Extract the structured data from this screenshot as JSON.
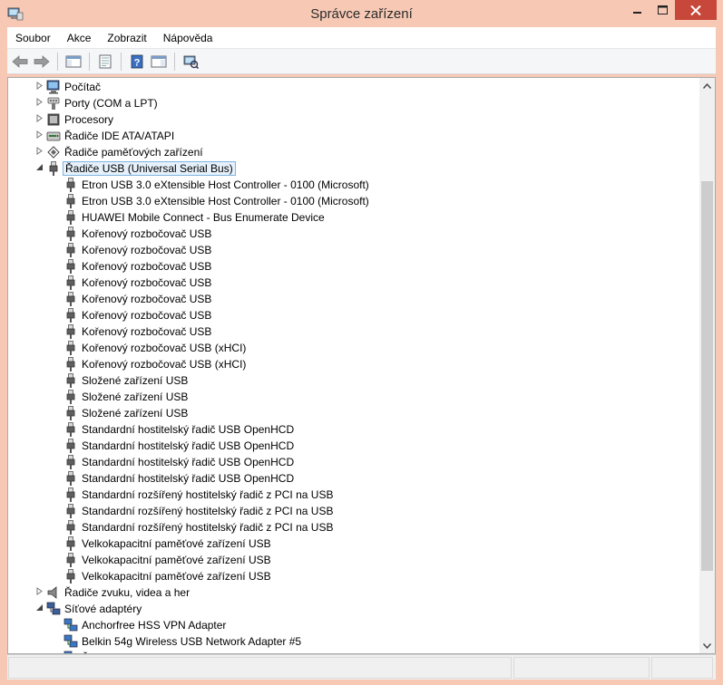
{
  "window": {
    "title": "Správce zařízení"
  },
  "menubar": [
    "Soubor",
    "Akce",
    "Zobrazit",
    "Nápověda"
  ],
  "toolbar": [
    "back-icon",
    "forward-icon",
    "show-hide-tree-icon",
    "properties-icon",
    "help-icon",
    "action-pane-icon",
    "scan-hardware-icon"
  ],
  "tree": [
    {
      "label": "Počítač",
      "level": 0,
      "expander": "collapsed",
      "icon": "computer-icon"
    },
    {
      "label": "Porty (COM a LPT)",
      "level": 0,
      "expander": "collapsed",
      "icon": "port-icon"
    },
    {
      "label": "Procesory",
      "level": 0,
      "expander": "collapsed",
      "icon": "processor-icon"
    },
    {
      "label": "Řadiče IDE ATA/ATAPI",
      "level": 0,
      "expander": "collapsed",
      "icon": "ide-controller-icon"
    },
    {
      "label": "Řadiče paměťových zařízení",
      "level": 0,
      "expander": "collapsed",
      "icon": "storage-controller-icon"
    },
    {
      "label": "Řadiče USB (Universal Serial Bus)",
      "level": 0,
      "expander": "expanded",
      "icon": "usb-icon",
      "selected": true
    },
    {
      "label": "Etron USB 3.0 eXtensible Host Controller - 0100 (Microsoft)",
      "level": 1,
      "icon": "usb-icon"
    },
    {
      "label": "Etron USB 3.0 eXtensible Host Controller - 0100 (Microsoft)",
      "level": 1,
      "icon": "usb-icon"
    },
    {
      "label": "HUAWEI Mobile Connect - Bus Enumerate Device",
      "level": 1,
      "icon": "usb-icon"
    },
    {
      "label": "Kořenový rozbočovač USB",
      "level": 1,
      "icon": "usb-icon"
    },
    {
      "label": "Kořenový rozbočovač USB",
      "level": 1,
      "icon": "usb-icon"
    },
    {
      "label": "Kořenový rozbočovač USB",
      "level": 1,
      "icon": "usb-icon"
    },
    {
      "label": "Kořenový rozbočovač USB",
      "level": 1,
      "icon": "usb-icon"
    },
    {
      "label": "Kořenový rozbočovač USB",
      "level": 1,
      "icon": "usb-icon"
    },
    {
      "label": "Kořenový rozbočovač USB",
      "level": 1,
      "icon": "usb-icon"
    },
    {
      "label": "Kořenový rozbočovač USB",
      "level": 1,
      "icon": "usb-icon"
    },
    {
      "label": "Kořenový rozbočovač USB (xHCI)",
      "level": 1,
      "icon": "usb-icon"
    },
    {
      "label": "Kořenový rozbočovač USB (xHCI)",
      "level": 1,
      "icon": "usb-icon"
    },
    {
      "label": "Složené zařízení USB",
      "level": 1,
      "icon": "usb-icon"
    },
    {
      "label": "Složené zařízení USB",
      "level": 1,
      "icon": "usb-icon"
    },
    {
      "label": "Složené zařízení USB",
      "level": 1,
      "icon": "usb-icon"
    },
    {
      "label": "Standardní hostitelský řadič  USB OpenHCD",
      "level": 1,
      "icon": "usb-icon"
    },
    {
      "label": "Standardní hostitelský řadič  USB OpenHCD",
      "level": 1,
      "icon": "usb-icon"
    },
    {
      "label": "Standardní hostitelský řadič  USB OpenHCD",
      "level": 1,
      "icon": "usb-icon"
    },
    {
      "label": "Standardní hostitelský řadič  USB OpenHCD",
      "level": 1,
      "icon": "usb-icon"
    },
    {
      "label": "Standardní rozšířený hostitelský řadič z PCI na USB",
      "level": 1,
      "icon": "usb-icon"
    },
    {
      "label": "Standardní rozšířený hostitelský řadič z PCI na USB",
      "level": 1,
      "icon": "usb-icon"
    },
    {
      "label": "Standardní rozšířený hostitelský řadič z PCI na USB",
      "level": 1,
      "icon": "usb-icon"
    },
    {
      "label": "Velkokapacitní paměťové zařízení USB",
      "level": 1,
      "icon": "usb-icon"
    },
    {
      "label": "Velkokapacitní paměťové zařízení USB",
      "level": 1,
      "icon": "usb-icon"
    },
    {
      "label": "Velkokapacitní paměťové zařízení USB",
      "level": 1,
      "icon": "usb-icon"
    },
    {
      "label": "Řadiče zvuku, videa a her",
      "level": 0,
      "expander": "collapsed",
      "icon": "speaker-icon"
    },
    {
      "label": "Síťové adaptéry",
      "level": 0,
      "expander": "expanded",
      "icon": "network-icon"
    },
    {
      "label": "Anchorfree HSS VPN Adapter",
      "level": 1,
      "icon": "network-adapter-icon"
    },
    {
      "label": "Belkin 54g Wireless USB Network Adapter #5",
      "level": 1,
      "icon": "network-adapter-icon"
    },
    {
      "label": "Řadič Realtek PCIe GBE Family Controller",
      "level": 1,
      "icon": "network-adapter-icon"
    }
  ],
  "colors": {
    "titlebar": "#f7c9b5",
    "close_button": "#c7483a",
    "selection_border": "#7fb4e0",
    "selection_fill": "#e6f1fb"
  }
}
